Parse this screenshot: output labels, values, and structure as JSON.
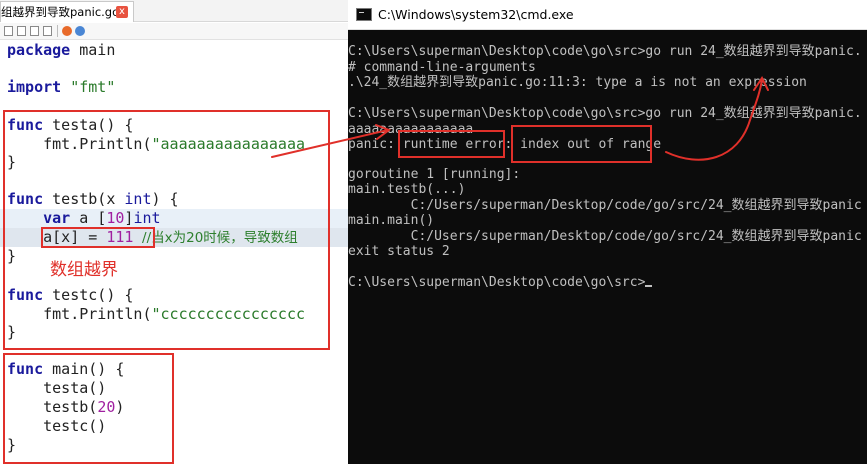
{
  "editor": {
    "tab_label": "组越界到导致panic.go",
    "tab_close": "x",
    "code": {
      "l1_kw": "package",
      "l1_rest": " main",
      "l2_kw": "import",
      "l2_str": "\"fmt\"",
      "l3_kw": "func",
      "l3_rest": " testa() {",
      "l4_pre": "    fmt.Println(",
      "l4_str": "\"aaaaaaaaaaaaaaaa",
      "l5": "}",
      "l6_kw": "func",
      "l6_rest": " testb(x ",
      "l6_ty": "int",
      "l6_end": ") {",
      "l7_kw": "    var",
      "l7_rest": " a [",
      "l7_num": "10",
      "l7_close": "]",
      "l7_ty": "int",
      "l8_pre": "    a[x] = ",
      "l8_num": "111",
      "l8_cm": "  //当x为20时候，导致数组",
      "l9": "}",
      "l10_kw": "func",
      "l10_rest": " testc() {",
      "l11_pre": "    fmt.Println(",
      "l11_str": "\"cccccccccccccccc",
      "l12": "}",
      "l13_kw": "func",
      "l13_rest": " main() {",
      "l14": "    testa()",
      "l15_pre": "    testb(",
      "l15_num": "20",
      "l15_end": ")",
      "l16": "    testc()",
      "l17": "}"
    },
    "annotation_label": "数组越界",
    "accent_red": "#e0302a"
  },
  "cmd": {
    "title": "C:\\Windows\\system32\\cmd.exe",
    "lines": [
      "C:\\Users\\superman\\Desktop\\code\\go\\src>go run 24_数组越界到导致panic.",
      "# command-line-arguments",
      ".\\24_数组越界到导致panic.go:11:3: type a is not an expression",
      "C:\\Users\\superman\\Desktop\\code\\go\\src>go run 24_数组越界到导致panic.",
      "aaaaaaaaaaaaaaaa",
      "panic: runtime error: index out of range",
      "goroutine 1 [running]:",
      "main.testb(...)",
      "        C:/Users/superman/Desktop/code/go/src/24_数组越界到导致panic",
      "main.main()",
      "        C:/Users/superman/Desktop/code/go/src/24_数组越界到导致panic",
      "exit status 2",
      "C:\\Users\\superman\\Desktop\\code\\go\\src>"
    ]
  }
}
